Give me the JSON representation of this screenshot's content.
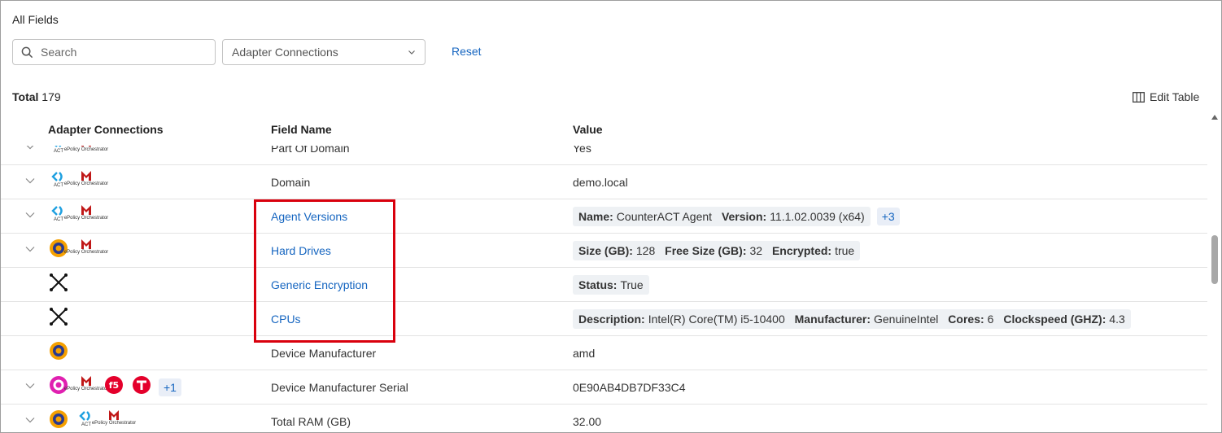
{
  "header": {
    "title": "All Fields"
  },
  "toolbar": {
    "search_placeholder": "Search",
    "filter_value": "Adapter Connections",
    "reset_label": "Reset",
    "total_label": "Total",
    "total_count": "179",
    "edit_table_label": "Edit Table"
  },
  "table": {
    "columns": [
      "Adapter Connections",
      "Field Name",
      "Value"
    ],
    "partial_row": {
      "field": "Part Of Domain",
      "value": "Yes"
    },
    "rows": [
      {
        "field": "Domain",
        "value": "demo.local"
      },
      {
        "field": "Agent Versions",
        "pairs": [
          [
            "Name:",
            "CounterACT Agent"
          ],
          [
            "Version:",
            "11.1.02.0039 (x64)"
          ]
        ],
        "more": "+3"
      },
      {
        "field": "Hard Drives",
        "pairs": [
          [
            "Size (GB):",
            "128"
          ],
          [
            "Free Size (GB):",
            "32"
          ],
          [
            "Encrypted:",
            "true"
          ]
        ]
      },
      {
        "field": "Generic Encryption",
        "pairs": [
          [
            "Status:",
            "True"
          ]
        ]
      },
      {
        "field": "CPUs",
        "pairs": [
          [
            "Description:",
            "Intel(R) Core(TM) i5-10400"
          ],
          [
            "Manufacturer:",
            "GenuineIntel"
          ],
          [
            "Cores:",
            "6"
          ],
          [
            "Clockspeed (GHZ):",
            "4.3"
          ]
        ]
      },
      {
        "field": "Device Manufacturer",
        "value": "amd"
      },
      {
        "field": "Device Manufacturer Serial",
        "value": "0E90AB4DB7DF33C4",
        "more": "+1"
      },
      {
        "field": "Total RAM (GB)",
        "value": "32.00"
      }
    ]
  },
  "adapters": {
    "act_caption": "ACT",
    "epo_caption": "ePolicy Orchestrator"
  },
  "colors": {
    "accent": "#1565c0",
    "highlight": "#d9000d",
    "mcafee": "#c01818"
  }
}
